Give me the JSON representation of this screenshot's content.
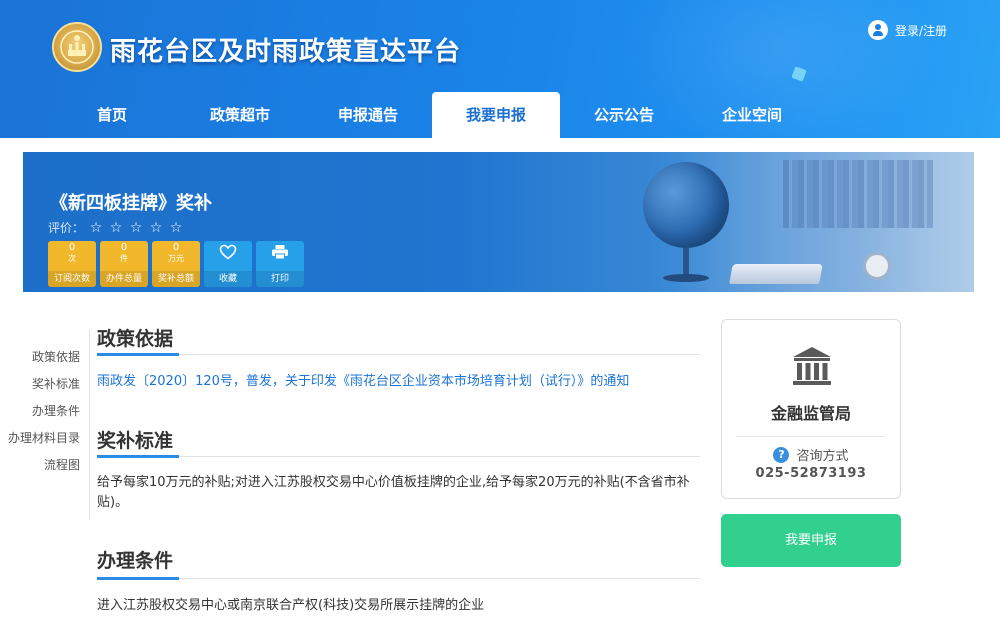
{
  "header": {
    "site_title": "雨花台区及时雨政策直达平台",
    "login_label": "登录/注册"
  },
  "nav": {
    "items": [
      {
        "label": "首页"
      },
      {
        "label": "政策超市"
      },
      {
        "label": "申报通告"
      },
      {
        "label": "我要申报",
        "active": true
      },
      {
        "label": "公示公告"
      },
      {
        "label": "企业空间"
      }
    ]
  },
  "banner": {
    "policy_title": "《新四板挂牌》奖补",
    "rating_label": "评价：",
    "rating_value": 0,
    "rating_max": 5,
    "star_glyph": "☆",
    "stats": [
      {
        "value": "0",
        "unit": "次",
        "caption": "订阅次数"
      },
      {
        "value": "0",
        "unit": "件",
        "caption": "办件总量"
      },
      {
        "value": "0",
        "unit": "万元",
        "caption": "奖补总额"
      }
    ],
    "actions": [
      {
        "icon": "heart-icon",
        "caption": "收藏"
      },
      {
        "icon": "printer-icon",
        "caption": "打印"
      }
    ]
  },
  "side_nav": {
    "items": [
      {
        "label": "政策依据"
      },
      {
        "label": "奖补标准"
      },
      {
        "label": "办理条件"
      },
      {
        "label": "办理材料目录"
      },
      {
        "label": "流程图"
      }
    ]
  },
  "sections": {
    "basis": {
      "title": "政策依据",
      "link_text": "雨政发〔2020〕120号，普发，关于印发《雨花台区企业资本市场培育计划（试行）》的通知"
    },
    "standard": {
      "title": "奖补标准",
      "text": "给予每家10万元的补贴;对进入江苏股权交易中心价值板挂牌的企业,给予每家20万元的补贴(不含省市补贴)。"
    },
    "conditions": {
      "title": "办理条件",
      "text": "进入江苏股权交易中心或南京联合产权(科技)交易所展示挂牌的企业"
    }
  },
  "card": {
    "icon": "bank-icon",
    "agency": "金融监管局",
    "consult_label": "咨询方式",
    "phone": "025-52873193"
  },
  "apply_button": {
    "label": "我要申报"
  },
  "colors": {
    "header_blue": "#1a7fe0",
    "accent_blue": "#2b8be5",
    "stat_yellow": "#f1b82b",
    "stat_blue": "#27a0ea",
    "apply_green": "#31d08f"
  }
}
